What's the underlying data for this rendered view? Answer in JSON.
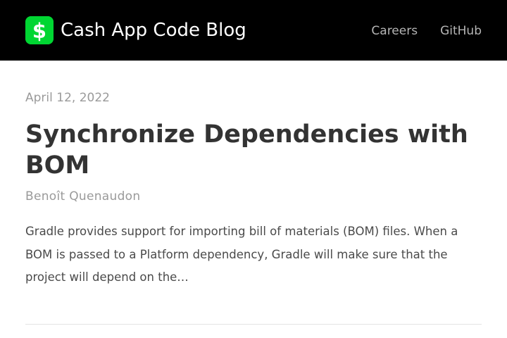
{
  "header": {
    "site_title": "Cash App Code Blog",
    "logo_icon": "cash-app-dollar-logo",
    "colors": {
      "background": "#000000",
      "logo": "#00d632",
      "title": "#ffffff",
      "nav": "#b5b5b5"
    },
    "nav": [
      {
        "label": "Careers"
      },
      {
        "label": "GitHub"
      }
    ]
  },
  "post": {
    "date": "April 12, 2022",
    "title": "Synchronize Dependencies with BOM",
    "author": "Benoît Quenaudon",
    "excerpt": "Gradle provides support for importing bill of materials (BOM) files. When a BOM is passed to a Platform dependency, Gradle will make sure that the project will depend on the…"
  }
}
